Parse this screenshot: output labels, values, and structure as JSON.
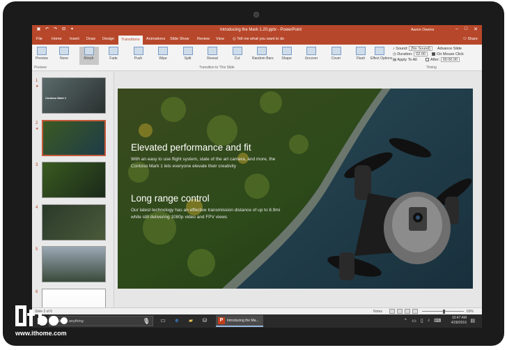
{
  "app": {
    "doc_title": "Introducing the Mark 1.20.pptx",
    "app_name": "PowerPoint",
    "user": "Aaron Owens"
  },
  "tabs": [
    {
      "label": "File"
    },
    {
      "label": "Home"
    },
    {
      "label": "Insert"
    },
    {
      "label": "Draw"
    },
    {
      "label": "Design"
    },
    {
      "label": "Transitions"
    },
    {
      "label": "Animations"
    },
    {
      "label": "Slide Show"
    },
    {
      "label": "Review"
    },
    {
      "label": "View"
    }
  ],
  "active_tab": "Transitions",
  "tellme": "Tell me what you want to do",
  "share": "Share",
  "ribbon": {
    "preview": "Preview",
    "transitions": [
      "None",
      "Morph",
      "Fade",
      "Push",
      "Wipe",
      "Split",
      "Reveal",
      "Cut",
      "Random Bars",
      "Shape",
      "Uncover",
      "Cover",
      "Flash"
    ],
    "effect_options": "Effect Options",
    "group_preview": "Preview",
    "group_transition": "Transition to This Slide",
    "group_timing": "Timing",
    "sound_label": "Sound:",
    "sound_value": "[No Sound]",
    "duration_label": "Duration:",
    "duration_value": "02.00",
    "apply_all": "Apply To All",
    "advance_slide": "Advance Slide",
    "on_mouse_click": "On Mouse Click",
    "after_label": "After:",
    "after_value": "00:00.00"
  },
  "thumbnails": [
    {
      "num": "1",
      "title": "Contoso Mark 1",
      "star": "★"
    },
    {
      "num": "2",
      "title": "",
      "star": "★"
    },
    {
      "num": "3",
      "title": "",
      "star": ""
    },
    {
      "num": "4",
      "title": "",
      "star": ""
    },
    {
      "num": "5",
      "title": "",
      "star": ""
    },
    {
      "num": "6",
      "title": "",
      "star": ""
    }
  ],
  "slide": {
    "heading1": "Elevated performance and fit",
    "body1": "With an easy to use flight system, state of the art camera, and more, the Contoso Mark 1 lets everyone elevate their creativity",
    "heading2": "Long range control",
    "body2": "Our latest technology has an effective transmission distance of up to 8.9mi while still delivering 1080p video and FPV views"
  },
  "statusbar": {
    "slide_count": "Slide 2 of 6",
    "notes": "Notes",
    "zoom": "69%"
  },
  "taskbar": {
    "search_placeholder": "Ask me anything",
    "active_app": "Introducing the Ma...",
    "time": "10:47 AM",
    "date": "4/28/2016"
  },
  "watermark": {
    "url": "www.ithome.com"
  },
  "colors": {
    "ppt_accent": "#b7472a",
    "bezel": "#1b1b1b",
    "taskbar": "#2a2a2a"
  }
}
